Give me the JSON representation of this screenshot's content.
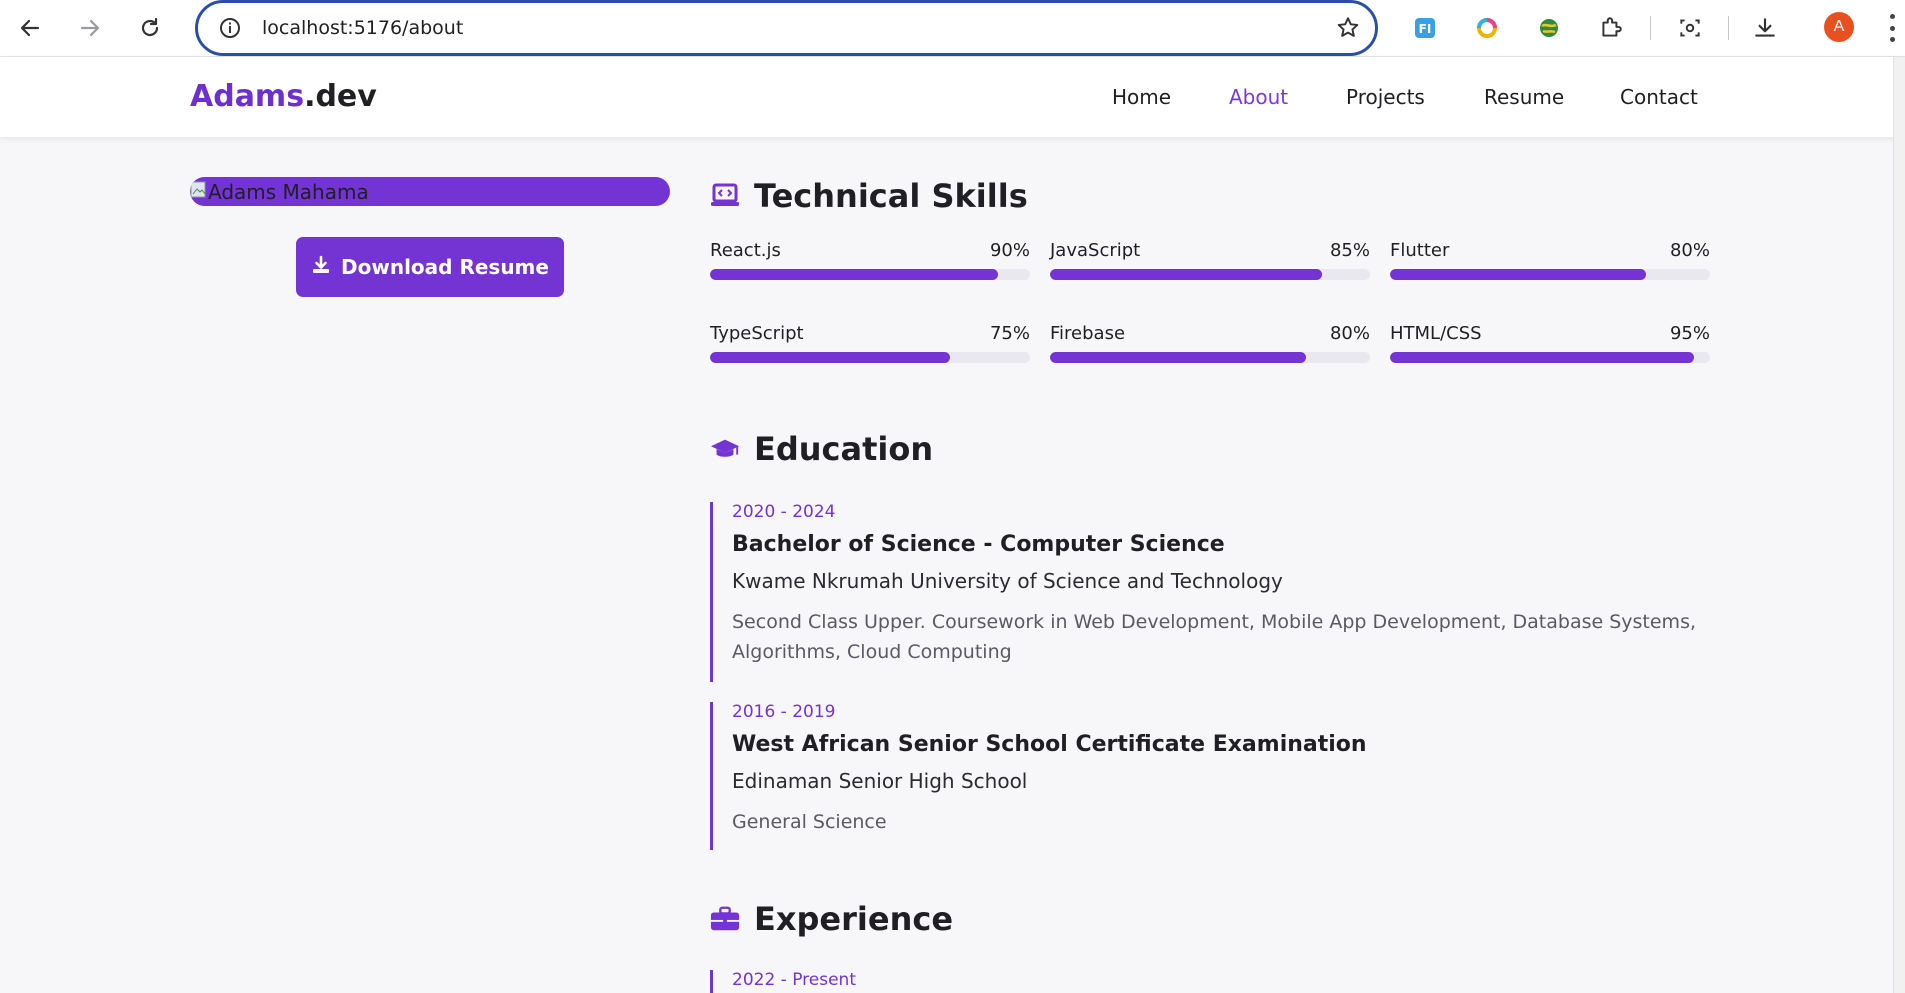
{
  "browser": {
    "url": "localhost:5176/about",
    "profile_initial": "A",
    "icons": [
      "back-icon",
      "forward-icon",
      "reload-icon",
      "info-icon",
      "star-icon",
      "extension-fi-icon",
      "extension-ring-icon",
      "extension-globe-icon",
      "puzzle-icon",
      "screenshot-icon",
      "download-icon",
      "menu-icon"
    ]
  },
  "site": {
    "brand_first": "Adams",
    "brand_second": ".dev",
    "nav": [
      {
        "label": "Home",
        "active": false
      },
      {
        "label": "About",
        "active": true
      },
      {
        "label": "Projects",
        "active": false
      },
      {
        "label": "Resume",
        "active": false
      },
      {
        "label": "Contact",
        "active": false
      }
    ],
    "accent": "#7433d3"
  },
  "profile": {
    "photo_alt": "Adams Mahama",
    "download_label": "Download Resume"
  },
  "skills": {
    "title": "Technical Skills",
    "items": [
      {
        "name": "React.js",
        "percent_label": "90%",
        "level": 0.9
      },
      {
        "name": "JavaScript",
        "percent_label": "85%",
        "level": 0.85
      },
      {
        "name": "Flutter",
        "percent_label": "80%",
        "level": 0.8
      },
      {
        "name": "TypeScript",
        "percent_label": "75%",
        "level": 0.75
      },
      {
        "name": "Firebase",
        "percent_label": "80%",
        "level": 0.8
      },
      {
        "name": "HTML/CSS",
        "percent_label": "95%",
        "level": 0.95
      }
    ]
  },
  "education": {
    "title": "Education",
    "items": [
      {
        "period": "2020 - 2024",
        "degree": "Bachelor of Science - Computer Science",
        "school": "Kwame Nkrumah University of Science and Technology",
        "description": "Second Class Upper. Coursework in Web Development, Mobile App Development, Database Systems, Algorithms, Cloud Computing"
      },
      {
        "period": "2016 - 2019",
        "degree": "West African Senior School Certificate Examination",
        "school": "Edinaman Senior High School",
        "description": "General Science"
      }
    ]
  },
  "experience": {
    "title": "Experience",
    "items": [
      {
        "period": "2022 - Present"
      }
    ]
  }
}
